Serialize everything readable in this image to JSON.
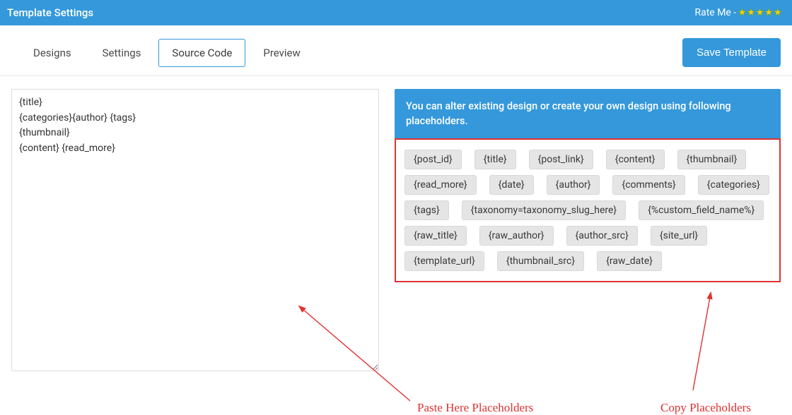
{
  "topbar": {
    "title": "Template Settings",
    "rate_label": "Rate Me - "
  },
  "tabs": {
    "designs": "Designs",
    "settings": "Settings",
    "source": "Source Code",
    "preview": "Preview"
  },
  "buttons": {
    "save": "Save Template"
  },
  "editor": {
    "content": "{title}\n{categories}{author} {tags}\n{thumbnail}\n{content} {read_more}"
  },
  "info": "You can alter existing design or create your own design using following placeholders.",
  "placeholders": [
    "{post_id}",
    "{title}",
    "{post_link}",
    "{content}",
    "{thumbnail}",
    "{read_more}",
    "{date}",
    "{author}",
    "{comments}",
    "{categories}",
    "{tags}",
    "{taxonomy=taxonomy_slug_here}",
    "{%custom_field_name%}",
    "{raw_title}",
    "{raw_author}",
    "{author_src}",
    "{site_url}",
    "{template_url}",
    "{thumbnail_src}",
    "{raw_date}"
  ],
  "annotations": {
    "paste": "Paste Here Placeholders",
    "copy": "Copy Placeholders"
  }
}
